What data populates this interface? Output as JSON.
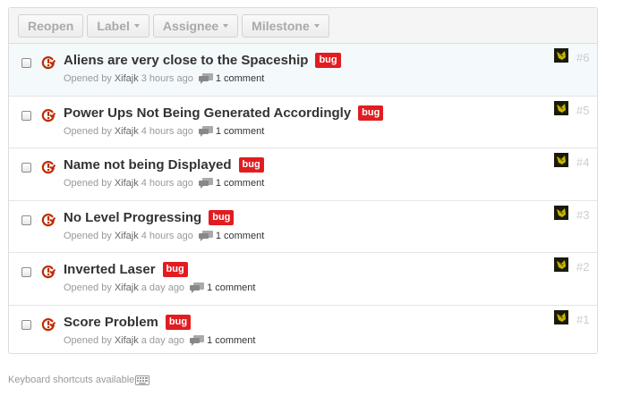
{
  "toolbar": {
    "reopen": "Reopen",
    "label": "Label",
    "assignee": "Assignee",
    "milestone": "Milestone"
  },
  "issues": [
    {
      "title": "Aliens are very close to the Spaceship",
      "label": "bug",
      "opened_by": "Opened by",
      "author": "Xifajk",
      "ago": "3 hours ago",
      "comments": "1 comment",
      "number": "#6"
    },
    {
      "title": "Power Ups Not Being Generated Accordingly",
      "label": "bug",
      "opened_by": "Opened by",
      "author": "Xifajk",
      "ago": "4 hours ago",
      "comments": "1 comment",
      "number": "#5"
    },
    {
      "title": "Name not being Displayed",
      "label": "bug",
      "opened_by": "Opened by",
      "author": "Xifajk",
      "ago": "4 hours ago",
      "comments": "1 comment",
      "number": "#4"
    },
    {
      "title": "No Level Progressing",
      "label": "bug",
      "opened_by": "Opened by",
      "author": "Xifajk",
      "ago": "4 hours ago",
      "comments": "1 comment",
      "number": "#3"
    },
    {
      "title": "Inverted Laser",
      "label": "bug",
      "opened_by": "Opened by",
      "author": "Xifajk",
      "ago": "a day ago",
      "comments": "1 comment",
      "number": "#2"
    },
    {
      "title": "Score Problem",
      "label": "bug",
      "opened_by": "Opened by",
      "author": "Xifajk",
      "ago": "a day ago",
      "comments": "1 comment",
      "number": "#1"
    }
  ],
  "footer": {
    "shortcuts": "Keyboard shortcuts available"
  },
  "colors": {
    "bug_label": "#e11d21",
    "closed_icon": "#bd2c00",
    "highlight_row": "#f4f9fc"
  },
  "icons": {
    "status": "issue-closed-icon",
    "comment": "comment-icon",
    "keyboard": "keyboard-icon"
  }
}
